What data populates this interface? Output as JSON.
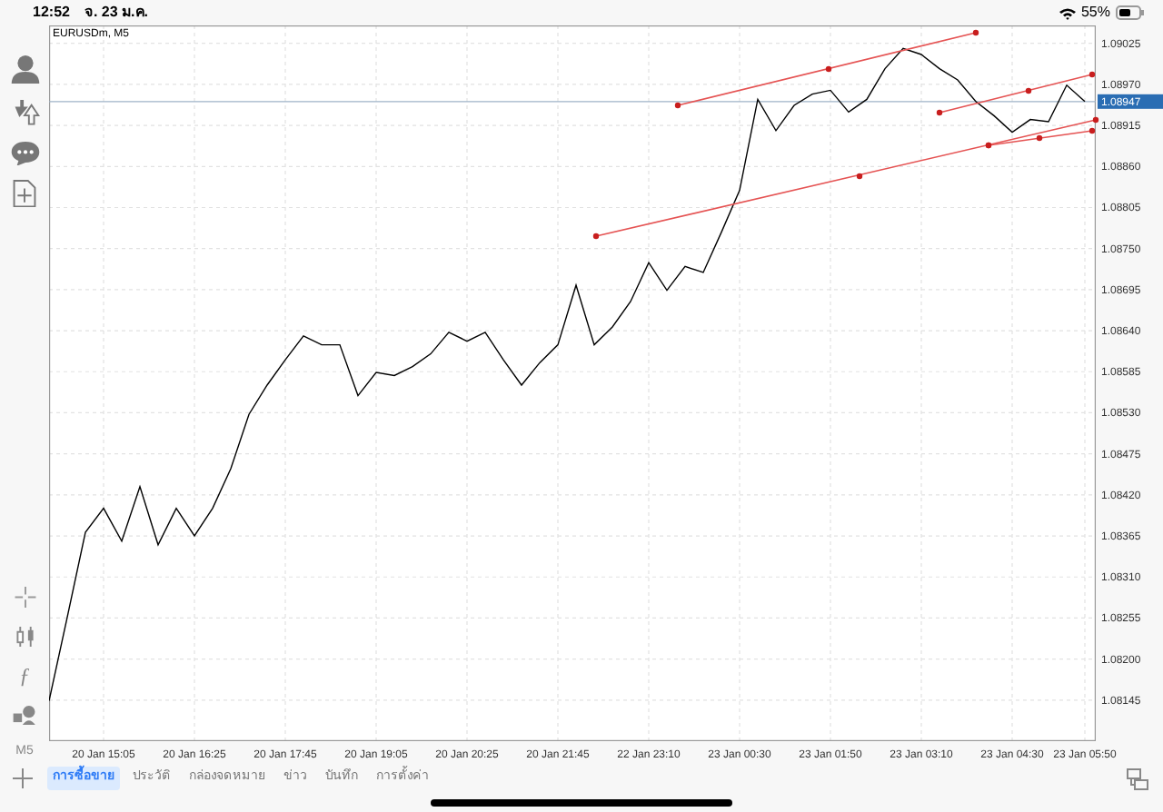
{
  "status_bar": {
    "time": "12:52",
    "date": "จ. 23 ม.ค.",
    "battery": "55%"
  },
  "chart": {
    "title": "EURUSDm, M5",
    "timeframe": "M5",
    "chart_data": {
      "type": "line",
      "grid": true,
      "ylim": [
        1.0809,
        1.09049
      ],
      "ref_lines": [
        {
          "axis": "y",
          "value": 1.08947,
          "label": "1.08947"
        }
      ],
      "categories": [
        null,
        null,
        null,
        "20 Jan 15:05",
        null,
        null,
        null,
        null,
        "20 Jan 16:25",
        null,
        null,
        null,
        null,
        "20 Jan 17:45",
        null,
        null,
        null,
        null,
        "20 Jan 19:05",
        null,
        null,
        null,
        null,
        "20 Jan 20:25",
        null,
        null,
        null,
        null,
        "20 Jan 21:45",
        null,
        null,
        null,
        null,
        "22 Jan 23:10",
        null,
        null,
        null,
        null,
        "23 Jan 00:30",
        null,
        null,
        null,
        null,
        "23 Jan 01:50",
        null,
        null,
        null,
        null,
        "23 Jan 03:10",
        null,
        null,
        null,
        null,
        "23 Jan 04:30",
        null,
        null,
        null,
        "23 Jan 05:50"
      ],
      "series": [
        {
          "color": "#000000",
          "values": [
            1.08144,
            1.08256,
            1.0837,
            1.08402,
            1.08358,
            1.08431,
            1.08353,
            1.08402,
            1.08365,
            1.08402,
            1.08455,
            1.08528,
            1.08567,
            1.08601,
            1.08633,
            1.08621,
            1.08621,
            1.08553,
            1.08584,
            1.0858,
            1.08592,
            1.08609,
            1.08638,
            1.08626,
            1.08638,
            1.08601,
            1.08567,
            1.08597,
            1.08621,
            1.08701,
            1.08621,
            1.08645,
            1.08679,
            1.08731,
            1.08694,
            1.08726,
            1.08718,
            1.08772,
            1.08828,
            1.0895,
            1.08908,
            1.08942,
            1.08957,
            1.08962,
            1.08933,
            1.0895,
            1.08991,
            1.09018,
            1.0901,
            1.08991,
            1.08976,
            1.08947,
            1.08928,
            1.08906,
            1.08923,
            1.0892,
            1.08969,
            1.08947
          ]
        }
      ],
      "yticks": [
        {
          "value": 1.09025,
          "label": "1.09025"
        },
        {
          "value": 1.0897,
          "label": "1.08970"
        },
        {
          "value": 1.08915,
          "label": "1.08915"
        },
        {
          "value": 1.0886,
          "label": "1.08860"
        },
        {
          "value": 1.08805,
          "label": "1.08805"
        },
        {
          "value": 1.0875,
          "label": "1.08750"
        },
        {
          "value": 1.08695,
          "label": "1.08695"
        },
        {
          "value": 1.0864,
          "label": "1.08640"
        },
        {
          "value": 1.08585,
          "label": "1.08585"
        },
        {
          "value": 1.0853,
          "label": "1.08530"
        },
        {
          "value": 1.08475,
          "label": "1.08475"
        },
        {
          "value": 1.0842,
          "label": "1.08420"
        },
        {
          "value": 1.08365,
          "label": "1.08365"
        },
        {
          "value": 1.0831,
          "label": "1.08310"
        },
        {
          "value": 1.08255,
          "label": "1.08255"
        },
        {
          "value": 1.082,
          "label": "1.08200"
        },
        {
          "value": 1.08145,
          "label": "1.08145"
        }
      ]
    }
  },
  "left_toolbar": {
    "function_glyph": "ƒ"
  },
  "tabs": [
    {
      "label": "การซื้อขาย",
      "selected": true
    },
    {
      "label": "ประวัติ",
      "selected": false
    },
    {
      "label": "กล่องจดหมาย",
      "selected": false
    },
    {
      "label": "ข่าว",
      "selected": false
    },
    {
      "label": "บันทึก",
      "selected": false
    },
    {
      "label": "การตั้งค่า",
      "selected": false
    }
  ]
}
